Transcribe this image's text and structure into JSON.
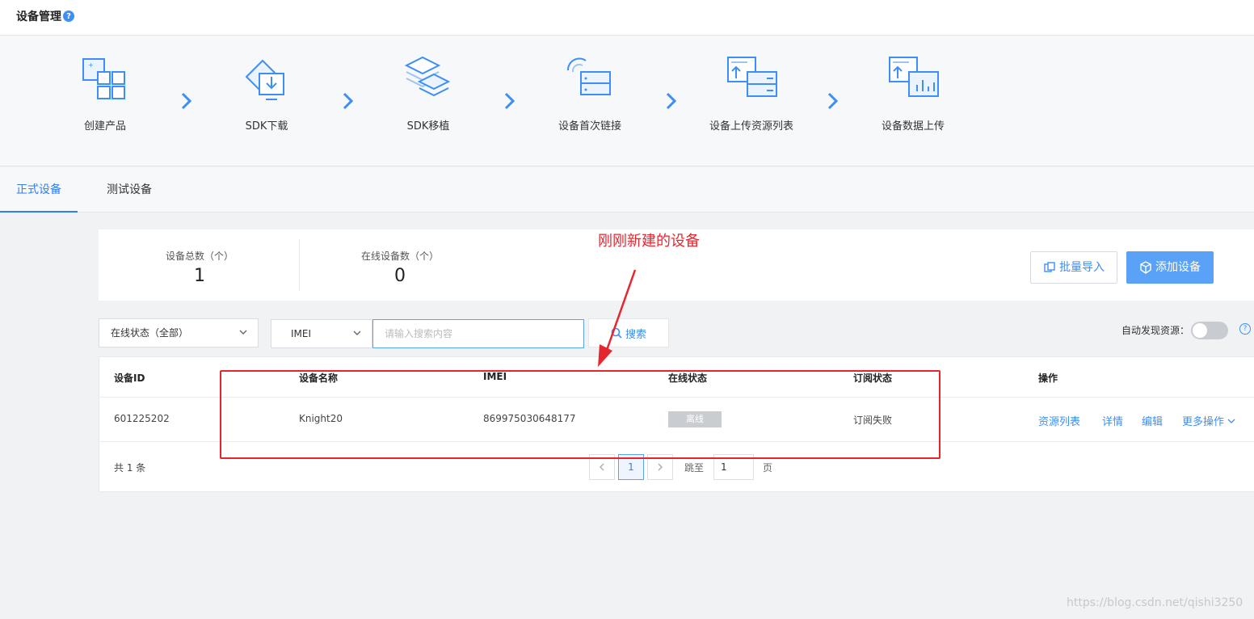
{
  "page": {
    "title": "设备管理",
    "help_glyph": "?"
  },
  "flow": {
    "steps": [
      {
        "label": "创建产品",
        "icon": "create-product-icon"
      },
      {
        "label": "SDK下载",
        "icon": "sdk-download-icon"
      },
      {
        "label": "SDK移植",
        "icon": "sdk-port-icon"
      },
      {
        "label": "设备首次链接",
        "icon": "device-first-link-icon"
      },
      {
        "label": "设备上传资源列表",
        "icon": "device-upload-resource-icon"
      },
      {
        "label": "设备数据上传",
        "icon": "device-data-upload-icon"
      }
    ]
  },
  "tabs": [
    {
      "label": "正式设备",
      "active": true
    },
    {
      "label": "测试设备",
      "active": false
    }
  ],
  "stats": {
    "total_label": "设备总数（个）",
    "total_value": "1",
    "online_label": "在线设备数（个）",
    "online_value": "0"
  },
  "actions": {
    "import_label": "批量导入",
    "add_label": "添加设备"
  },
  "annotation": {
    "text": "刚刚新建的设备",
    "color": "#e6262e"
  },
  "filters": {
    "status_select": "在线状态（全部）",
    "field_select": "IMEI",
    "search_placeholder": "请输入搜索内容",
    "search_value": "",
    "search_button": "搜索",
    "auto_discover_label": "自动发现资源：",
    "auto_discover_on": false,
    "help_glyph": "?"
  },
  "table": {
    "headers": [
      "设备ID",
      "设备名称",
      "IMEI",
      "在线状态",
      "订阅状态",
      "操作"
    ],
    "rows": [
      {
        "device_id": "601225202",
        "name": "Knight20",
        "imei": "869975030648177",
        "online": "离线",
        "subscription": "订阅失败",
        "actions": [
          "资源列表",
          "详情",
          "编辑",
          "更多操作"
        ]
      }
    ],
    "total_text": "共 1 条",
    "pagination": {
      "current_page": "1",
      "jump_prefix": "跳至",
      "jump_value": "1",
      "jump_suffix": "页"
    }
  },
  "watermark": "https://blog.csdn.net/qishi3250",
  "colors": {
    "accent": "#3e8ef7",
    "primary_button": "#5aa2f7",
    "highlight": "#e6262e"
  }
}
